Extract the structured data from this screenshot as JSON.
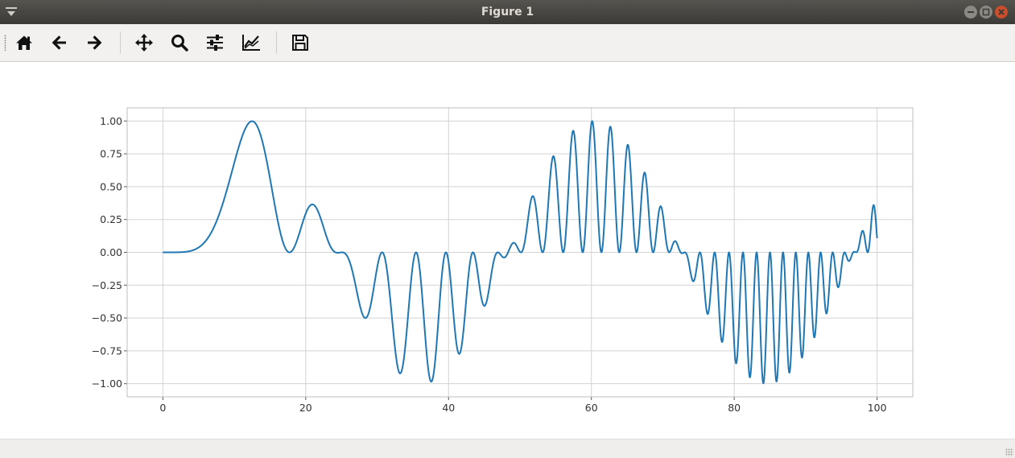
{
  "window": {
    "title": "Figure 1"
  },
  "toolbar": {
    "buttons": [
      {
        "name": "home",
        "icon": "home-icon"
      },
      {
        "name": "back",
        "icon": "arrow-left-icon"
      },
      {
        "name": "forward",
        "icon": "arrow-right-icon"
      },
      {
        "name": "pan",
        "icon": "move-icon"
      },
      {
        "name": "zoom",
        "icon": "zoom-icon"
      },
      {
        "name": "subplots",
        "icon": "sliders-icon"
      },
      {
        "name": "axes",
        "icon": "axes-edit-icon"
      },
      {
        "name": "save",
        "icon": "save-icon"
      }
    ]
  },
  "colors": {
    "line": "#1f77b4",
    "grid": "#d3d3d3",
    "titlebar": "#3e3d39",
    "close": "#c94e2c"
  },
  "chart_data": {
    "type": "line",
    "title": "",
    "xlabel": "",
    "ylabel": "",
    "xlim": [
      -5,
      105
    ],
    "ylim": [
      -1.1,
      1.1
    ],
    "grid": true,
    "x_ticks": [
      0,
      20,
      40,
      60,
      80,
      100
    ],
    "x_tick_labels": [
      "0",
      "20",
      "40",
      "60",
      "80",
      "100"
    ],
    "y_ticks": [
      1.0,
      0.75,
      0.5,
      0.25,
      0.0,
      -0.25,
      -0.5,
      -0.75,
      -1.0
    ],
    "y_tick_labels": [
      "1.00",
      "0.75",
      "0.50",
      "0.25",
      "0.00",
      "−0.25",
      "−0.50",
      "−0.75",
      "−1.00"
    ],
    "series": [
      {
        "x_range": [
          0,
          100
        ],
        "num_points": 2000,
        "approx_function": "sin(0.13*x) * sin(0.01*x^2)^2",
        "color": "#1f77b4"
      }
    ]
  }
}
